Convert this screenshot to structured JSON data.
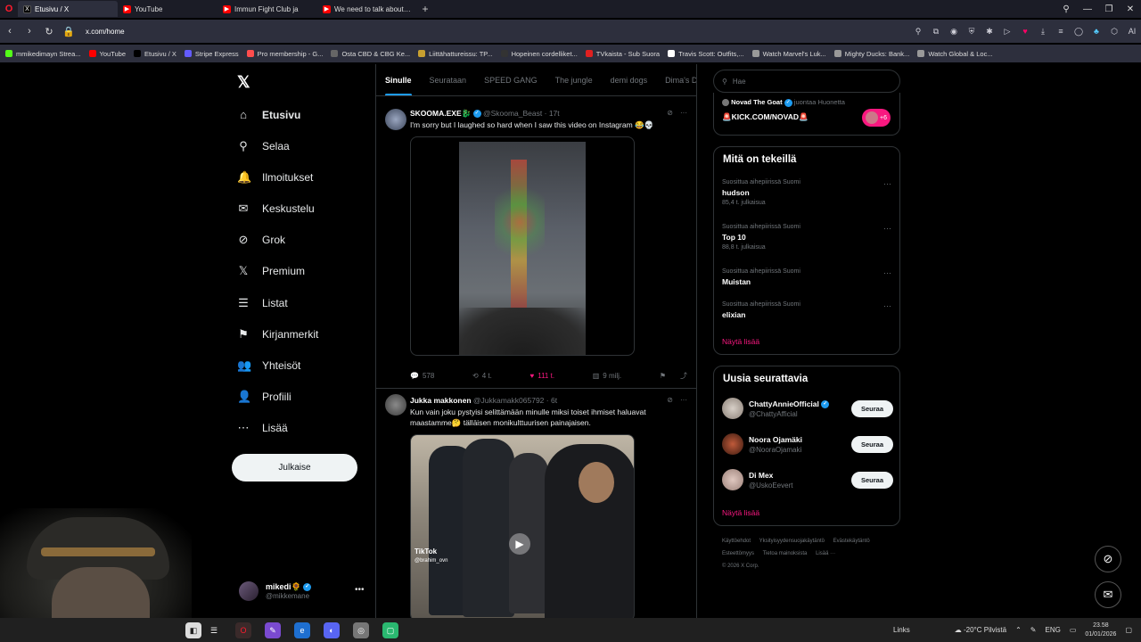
{
  "browser": {
    "tabs": [
      {
        "label": "Etusivu / X",
        "icon": "x-logo",
        "color": "#000000",
        "active": true
      },
      {
        "label": "YouTube",
        "icon": "youtube-logo",
        "color": "#ff0000",
        "active": false
      },
      {
        "label": "Immun Fight Club ja",
        "icon": "youtube-logo",
        "color": "#ff0000",
        "active": false
      },
      {
        "label": "We need to talk about thi",
        "icon": "youtube-logo",
        "color": "#ff0000",
        "active": false
      }
    ],
    "url": "x.com/home",
    "bookmarks": [
      {
        "label": "mmikedimayn Strea...",
        "icon": "kick-logo",
        "color": "#53fc18"
      },
      {
        "label": "YouTube",
        "icon": "youtube-logo",
        "color": "#ff0000"
      },
      {
        "label": "Etusivu / X",
        "icon": "x-logo",
        "color": "#000000"
      },
      {
        "label": "Stripe Express",
        "icon": "stripe-logo",
        "color": "#635bff"
      },
      {
        "label": "Pro membership - G...",
        "icon": "pin-logo",
        "color": "#ff4d4d"
      },
      {
        "label": "Osta CBD & CBG Ke...",
        "icon": "globe-logo",
        "color": "#666666"
      },
      {
        "label": "Liittähattureissu: TP...",
        "icon": "hat-logo",
        "color": "#c8a030"
      },
      {
        "label": "Hopeinen cordelliket...",
        "icon": "rt-logo",
        "color": "#333333"
      },
      {
        "label": "TVkaista - Sub Suora",
        "icon": "tv-logo",
        "color": "#e02020"
      },
      {
        "label": "Travis Scott: Outfits,...",
        "icon": "w-logo",
        "color": "#ffffff"
      },
      {
        "label": "Watch Marvel's Luk...",
        "icon": "gear-logo",
        "color": "#999999"
      },
      {
        "label": "Mighty Ducks: Bank...",
        "icon": "leaf-logo",
        "color": "#999999"
      },
      {
        "label": "Watch Global & Loc...",
        "icon": "leaf-logo",
        "color": "#999999"
      }
    ]
  },
  "nav": {
    "items": [
      {
        "label": "Etusivu",
        "icon": "home-icon",
        "glyph": "⌂"
      },
      {
        "label": "Selaa",
        "icon": "search-icon",
        "glyph": "⚲"
      },
      {
        "label": "Ilmoitukset",
        "icon": "bell-icon",
        "glyph": "🔔"
      },
      {
        "label": "Keskustelu",
        "icon": "mail-icon",
        "glyph": "✉"
      },
      {
        "label": "Grok",
        "icon": "grok-icon",
        "glyph": "⊘"
      },
      {
        "label": "Premium",
        "icon": "x-premium-icon",
        "glyph": "𝕏"
      },
      {
        "label": "Listat",
        "icon": "list-icon",
        "glyph": "☰"
      },
      {
        "label": "Kirjanmerkit",
        "icon": "bookmark-icon",
        "glyph": "⚑"
      },
      {
        "label": "Yhteisöt",
        "icon": "communities-icon",
        "glyph": "👥"
      },
      {
        "label": "Profiili",
        "icon": "profile-icon",
        "glyph": "👤"
      },
      {
        "label": "Lisää",
        "icon": "more-icon",
        "glyph": "⋯"
      }
    ],
    "post_button": "Julkaise",
    "account": {
      "name": "mikedi🌻",
      "handle": "@mikkemane"
    }
  },
  "feed": {
    "tabs": [
      "Sinulle",
      "Seurataan",
      "SPEED GANG",
      "The jungle",
      "demi dogs",
      "Dima's Di"
    ],
    "tweets": [
      {
        "name": "SKOOMA.EXE🐉",
        "handle": "@Skooma_Beast",
        "time": "· 17t",
        "text": "I'm sorry but I laughed so hard when I saw this video on Instagram 😂💀",
        "replies": "578",
        "reposts": "4 t.",
        "likes": "111 t.",
        "views": "9 milj."
      },
      {
        "name": "Jukka makkonen",
        "handle": "@Jukkamakk065792",
        "time": "· 6t",
        "text": "Kun vain joku pystyisi selittämään minulle miksi toiset ihmiset haluavat maastamme🤔 tälläisen monikulttuurisen painajaisen.",
        "watermark": "TikTok",
        "watermark_handle": "@brahim_ovn"
      }
    ]
  },
  "rail": {
    "search_placeholder": "Hae",
    "live": {
      "name": "Novad The Goat",
      "action": "juontaa Huonetta",
      "title": "🚨KICK.COM/NOVAD🚨",
      "count": "+6"
    },
    "trending_title": "Mitä on tekeillä",
    "trends": [
      {
        "context": "Suosittua aihepiirissä Suomi",
        "topic": "hudson",
        "count": "85,4 t. julkaisua"
      },
      {
        "context": "Suosittua aihepiirissä Suomi",
        "topic": "Top 10",
        "count": "88,8 t. julkaisua"
      },
      {
        "context": "Suosittua aihepiirissä Suomi",
        "topic": "Muistan",
        "count": ""
      },
      {
        "context": "Suosittua aihepiirissä Suomi",
        "topic": "elixian",
        "count": ""
      }
    ],
    "show_more": "Näytä lisää",
    "who_to_follow_title": "Uusia seurattavia",
    "follow_label": "Seuraa",
    "suggestions": [
      {
        "name": "ChattyAnnieOfficial",
        "handle": "@ChattyAfficial",
        "verified": true
      },
      {
        "name": "Noora Ojamäki",
        "handle": "@NooraOjamaki",
        "verified": false
      },
      {
        "name": "Di Mex",
        "handle": "@UskoEevert",
        "verified": false
      }
    ],
    "footer": [
      "Käyttöehdot",
      "Yksityisyydensuojakäytäntö",
      "Evästekäytäntö",
      "Esteettömyys",
      "Tietoa mainoksista",
      "Lisää ···",
      "© 2026 X Corp."
    ]
  },
  "taskbar": {
    "links": "Links",
    "weather": "-20°C Pilvistä",
    "lang": "ENG",
    "time": "23.58",
    "date": "01/01/2026"
  },
  "colors": {
    "accent": "#1d9bf0",
    "like": "#f91880",
    "background": "#000000"
  }
}
